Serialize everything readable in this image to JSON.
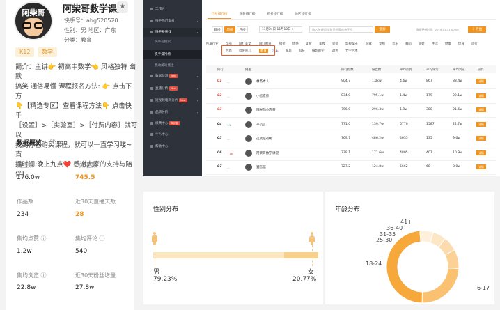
{
  "profile": {
    "avatar_text": "阿柴哥",
    "name": "阿柴哥数学课堂",
    "id_line": "快手号：ahg520520",
    "gender_region": "性别：男   地区：广东",
    "category": "分类：教育",
    "tags": [
      "K12",
      "数学"
    ],
    "intro_lines": [
      "简介：主讲👉 初高中数学👈 风格独特 幽默",
      "搞笑 通俗易懂 课程报名方法: 👉 点击下方",
      "👇【精选专区】查看课程方法👇 点击快手",
      "［设置］>［实验室］>［付费内容］就可以",
      "找到你已购买课程，就可以一直学习喽~ 直",
      "播时间:晚上九点❤️ 感谢大家的支持与陪伴!"
    ]
  },
  "overview": {
    "title": "数据概览",
    "stats": [
      {
        "label": "粉丝数",
        "value": "176.0w",
        "highlight": false
      },
      {
        "label": "飞瓜指数",
        "value": "745.5",
        "highlight": true
      },
      {
        "label": "作品数",
        "value": "234",
        "highlight": false
      },
      {
        "label": "近30天直播天数",
        "value": "28",
        "highlight": true
      },
      {
        "label": "集均点赞",
        "value": "1.2w",
        "highlight": false,
        "info": true
      },
      {
        "label": "集均评论",
        "value": "540",
        "highlight": false,
        "info": true
      },
      {
        "label": "集均浏览",
        "value": "22.8w",
        "highlight": false,
        "info": true
      },
      {
        "label": "近30天粉丝增量",
        "value": "27.8w",
        "highlight": false
      }
    ]
  },
  "dashboard": {
    "nav": [
      {
        "label": "工作台",
        "type": "item"
      },
      {
        "label": "快手热门素材",
        "type": "item",
        "arrow": true
      },
      {
        "label": "快手号查找",
        "type": "active-head",
        "arrow": true
      },
      {
        "label": "快手号搜索",
        "type": "sub"
      },
      {
        "label": "快手排行榜",
        "type": "current"
      },
      {
        "label": "我收藏的播主",
        "type": "sub"
      },
      {
        "label": "数据监测",
        "type": "item",
        "badge": "New",
        "arrow": true
      },
      {
        "label": "直播分析",
        "type": "item",
        "badge": "New",
        "arrow": true
      },
      {
        "label": "短视频电商分析",
        "type": "item",
        "badge": "New",
        "arrow": true
      },
      {
        "label": "品牌分析",
        "type": "item",
        "arrow": true
      },
      {
        "label": "续费中心",
        "type": "item",
        "badge": "享优惠"
      },
      {
        "label": "个人中心",
        "type": "item"
      },
      {
        "label": "帮助中心",
        "type": "item"
      }
    ],
    "tabs": [
      "行业排行榜",
      "涨粉排行榜",
      "成长排行榜",
      "地区排行榜"
    ],
    "periods": [
      "日榜",
      "周榜",
      "月榜"
    ],
    "date_range": "11月04日-11月10日",
    "search_placeholder": "输入关键词找到您想要的快手号",
    "search_label": "搜索",
    "update_note": "数据更新时间：2019-11-11 00:00",
    "export_label": "导出",
    "category_label": "所属行业：",
    "categories_row1": [
      "全部",
      "网红美女",
      "网红帅哥",
      "搞笑",
      "情感",
      "美食",
      "美妆",
      "穿搭",
      "影视娱乐",
      "游戏",
      "宠物",
      "音乐",
      "舞蹈",
      "萌娃",
      "生活",
      "健康",
      "体育",
      "旅行"
    ],
    "categories_row2": [
      "时尚",
      "母婴育儿",
      "教育",
      "汽车",
      "家居",
      "科技",
      "摄影教学",
      "政务",
      "文学艺术"
    ],
    "active_category": "教育",
    "columns": [
      "排行",
      "播主",
      "排行指数",
      "粉丝数",
      "平均点赞",
      "平均评论",
      "平均浏览",
      "操作"
    ],
    "detail_label": "详情",
    "rows": [
      {
        "rank": "01",
        "change": "—",
        "change_dir": "flat",
        "name": "林杰本人",
        "index": "904.7",
        "fans": "1.0kw",
        "likes": "4.6w",
        "comments": "867",
        "views": "88.4w"
      },
      {
        "rank": "02",
        "change": "—",
        "change_dir": "flat",
        "name": "小智老师",
        "index": "834.0",
        "fans": "795.1w",
        "likes": "1.4w",
        "comments": "179",
        "views": "22.1w"
      },
      {
        "rank": "03",
        "change": "—",
        "change_dir": "flat",
        "name": "阳光的小赤哥",
        "index": "796.0",
        "fans": "296.3w",
        "likes": "1.9w",
        "comments": "388",
        "views": "21.6w"
      },
      {
        "rank": "04",
        "change": "↓1",
        "change_dir": "up",
        "name": "辛沉言",
        "index": "771.0",
        "fans": "139.7w",
        "likes": "5770",
        "comments": "1587",
        "views": "22.7w"
      },
      {
        "rank": "05",
        "change": "—",
        "change_dir": "flat",
        "name": "这就是有用",
        "index": "769.7",
        "fans": "486.2w",
        "likes": "4635",
        "comments": "135",
        "views": "9.6w"
      },
      {
        "rank": "06",
        "change": "↑16",
        "change_dir": "down",
        "name": "阿柴哥数学课堂",
        "index": "739.1",
        "fans": "171.6w",
        "likes": "4805",
        "comments": "407",
        "views": "10.9w"
      },
      {
        "rank": "07",
        "change": "—",
        "change_dir": "flat",
        "name": "猫言信",
        "index": "727.2",
        "fans": "124.8w",
        "likes": "5662",
        "comments": "68",
        "views": "8.0w"
      }
    ]
  },
  "gender": {
    "title": "性别分布",
    "male_label": "男",
    "male_pct": "79.23%",
    "female_label": "女",
    "female_pct": "20.77%",
    "male_value": 79.23,
    "colors": {
      "male": "#f9cf8c",
      "female": "#fce6c0",
      "icon": "#f6c27a"
    }
  },
  "age": {
    "title": "年龄分布",
    "chart_data": {
      "type": "pie",
      "title": "年龄分布",
      "categories": [
        "6-17",
        "18-24",
        "25-30",
        "31-35",
        "36-40",
        "41+"
      ],
      "values": [
        48.5,
        24.5,
        8.5,
        6.5,
        6.0,
        6.0
      ],
      "colors": [
        "#f7a83b",
        "#f9c170",
        "#fbd196",
        "#fcdcae",
        "#fde6c3",
        "#fef0db"
      ]
    }
  }
}
